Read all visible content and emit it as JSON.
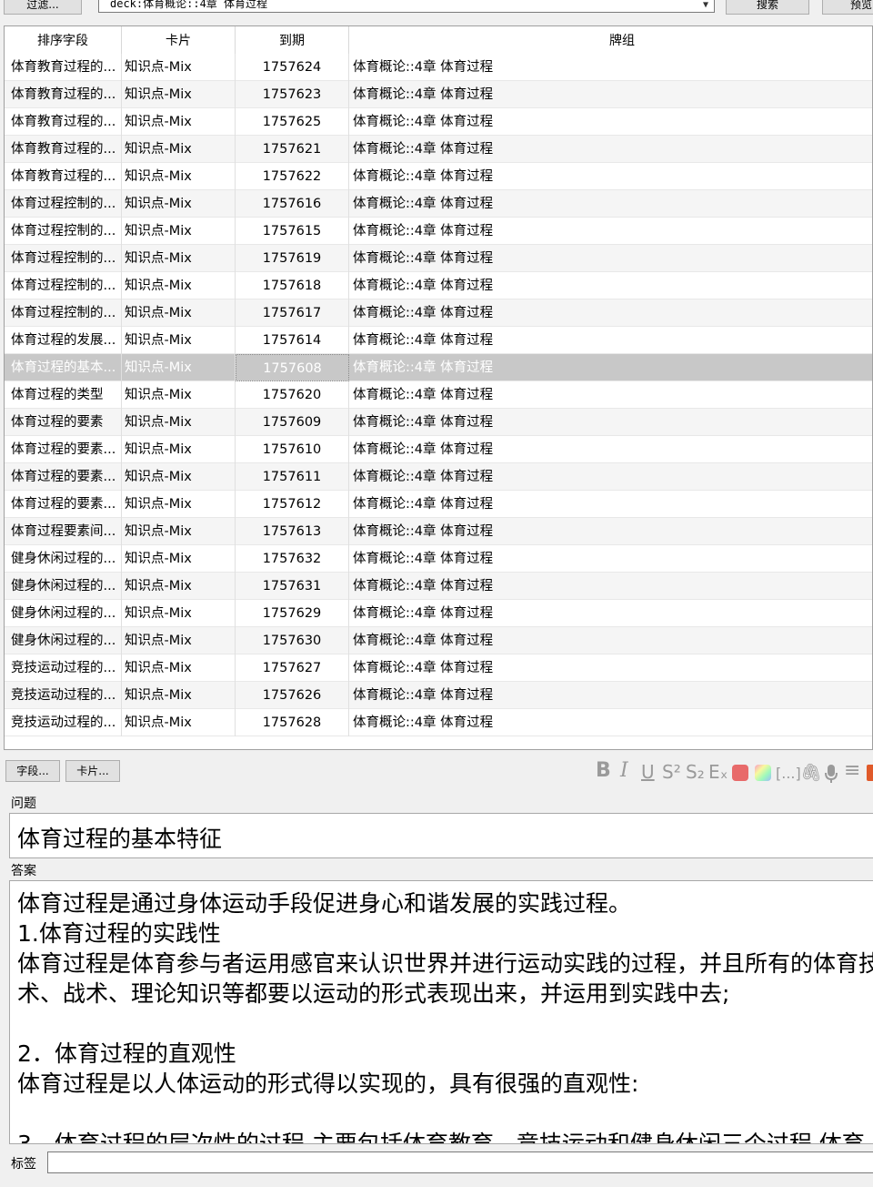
{
  "toolbar": {
    "filter_label": "过滤...",
    "search_value": "deck:体育概论::4章 体育过程",
    "search_button": "搜索",
    "preview_button": "预览"
  },
  "table": {
    "columns": [
      "排序字段",
      "卡片",
      "到期",
      "牌组"
    ],
    "selected_index": 11,
    "rows": [
      {
        "sort": "体育教育过程的...",
        "card": "知识点-Mix",
        "due": "1757624",
        "deck": "体育概论::4章 体育过程"
      },
      {
        "sort": "体育教育过程的...",
        "card": "知识点-Mix",
        "due": "1757623",
        "deck": "体育概论::4章 体育过程"
      },
      {
        "sort": "体育教育过程的...",
        "card": "知识点-Mix",
        "due": "1757625",
        "deck": "体育概论::4章 体育过程"
      },
      {
        "sort": "体育教育过程的...",
        "card": "知识点-Mix",
        "due": "1757621",
        "deck": "体育概论::4章 体育过程"
      },
      {
        "sort": "体育教育过程的...",
        "card": "知识点-Mix",
        "due": "1757622",
        "deck": "体育概论::4章 体育过程"
      },
      {
        "sort": "体育过程控制的...",
        "card": "知识点-Mix",
        "due": "1757616",
        "deck": "体育概论::4章 体育过程"
      },
      {
        "sort": "体育过程控制的...",
        "card": "知识点-Mix",
        "due": "1757615",
        "deck": "体育概论::4章 体育过程"
      },
      {
        "sort": "体育过程控制的...",
        "card": "知识点-Mix",
        "due": "1757619",
        "deck": "体育概论::4章 体育过程"
      },
      {
        "sort": "体育过程控制的...",
        "card": "知识点-Mix",
        "due": "1757618",
        "deck": "体育概论::4章 体育过程"
      },
      {
        "sort": "体育过程控制的...",
        "card": "知识点-Mix",
        "due": "1757617",
        "deck": "体育概论::4章 体育过程"
      },
      {
        "sort": "体育过程的发展...",
        "card": "知识点-Mix",
        "due": "1757614",
        "deck": "体育概论::4章 体育过程"
      },
      {
        "sort": "体育过程的基本...",
        "card": "知识点-Mix",
        "due": "1757608",
        "deck": "体育概论::4章 体育过程"
      },
      {
        "sort": "体育过程的类型",
        "card": "知识点-Mix",
        "due": "1757620",
        "deck": "体育概论::4章 体育过程"
      },
      {
        "sort": "体育过程的要素",
        "card": "知识点-Mix",
        "due": "1757609",
        "deck": "体育概论::4章 体育过程"
      },
      {
        "sort": "体育过程的要素...",
        "card": "知识点-Mix",
        "due": "1757610",
        "deck": "体育概论::4章 体育过程"
      },
      {
        "sort": "体育过程的要素...",
        "card": "知识点-Mix",
        "due": "1757611",
        "deck": "体育概论::4章 体育过程"
      },
      {
        "sort": "体育过程的要素...",
        "card": "知识点-Mix",
        "due": "1757612",
        "deck": "体育概论::4章 体育过程"
      },
      {
        "sort": "体育过程要素间...",
        "card": "知识点-Mix",
        "due": "1757613",
        "deck": "体育概论::4章 体育过程"
      },
      {
        "sort": "健身休闲过程的...",
        "card": "知识点-Mix",
        "due": "1757632",
        "deck": "体育概论::4章 体育过程"
      },
      {
        "sort": "健身休闲过程的...",
        "card": "知识点-Mix",
        "due": "1757631",
        "deck": "体育概论::4章 体育过程"
      },
      {
        "sort": "健身休闲过程的...",
        "card": "知识点-Mix",
        "due": "1757629",
        "deck": "体育概论::4章 体育过程"
      },
      {
        "sort": "健身休闲过程的...",
        "card": "知识点-Mix",
        "due": "1757630",
        "deck": "体育概论::4章 体育过程"
      },
      {
        "sort": "竞技运动过程的...",
        "card": "知识点-Mix",
        "due": "1757627",
        "deck": "体育概论::4章 体育过程"
      },
      {
        "sort": "竞技运动过程的...",
        "card": "知识点-Mix",
        "due": "1757626",
        "deck": "体育概论::4章 体育过程"
      },
      {
        "sort": "竞技运动过程的...",
        "card": "知识点-Mix",
        "due": "1757628",
        "deck": "体育概论::4章 体育过程"
      }
    ]
  },
  "editor": {
    "fields_button": "字段...",
    "cards_button": "卡片...",
    "format_icons": [
      "bold-icon",
      "italic-icon",
      "underline-icon",
      "superscript-icon",
      "subscript-icon",
      "clear-format-icon",
      "text-color-icon",
      "highlight-icon",
      "cloze-icon",
      "attach-icon",
      "record-icon",
      "menu-icon"
    ],
    "format_glyphs": {
      "bold": "B",
      "italic": "I",
      "underline": "U",
      "superscript": "S²",
      "subscript": "S₂",
      "clear": "Eₓ",
      "cloze": "[...]",
      "menu": "≡"
    },
    "colors": {
      "text_color": "#e53935",
      "highlight": "#7bd3ea"
    },
    "question_label": "问题",
    "question_value": "体育过程的基本特征",
    "answer_label": "答案",
    "answer_value": "体育过程是通过身体运动手段促进身心和谐发展的实践过程。\n1.体育过程的实践性\n体育过程是体育参与者运用感官来认识世界并进行运动实践的过程，并且所有的体育技术、战术、理论知识等都要以运动的形式表现出来，并运用到实践中去;\n\n2．体育过程的直观性\n体育过程是以人体运动的形式得以实现的，具有很强的直观性:\n\n3．体育过程的层次性的过程.主要包括体育教育、竞技运动和健身休闲三个过程.体育",
    "tags_label": "标签",
    "tags_value": ""
  }
}
